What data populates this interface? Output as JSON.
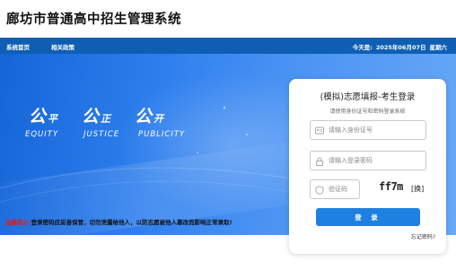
{
  "header": {
    "title": "廊坊市普通高中招生管理系统"
  },
  "nav": {
    "items": [
      {
        "label": "系统首页"
      },
      {
        "label": "相关政策"
      }
    ],
    "date_label": "今天是:",
    "date_value": "2025年06月07日",
    "weekday": "星期六"
  },
  "banner": {
    "slogan": [
      {
        "big": "公",
        "small": "平",
        "en": "EQUITY"
      },
      {
        "big": "公",
        "small": "正",
        "en": "JUSTICE"
      },
      {
        "big": "公",
        "small": "开",
        "en": "PUBLICITY"
      }
    ]
  },
  "notice": {
    "label": "温馨提示:",
    "text": "登录密码应妥善保管，切勿泄露给他人，以防志愿被他人篡改而影响正常录取!"
  },
  "login": {
    "title": "(模拟)志愿填报-考生登录",
    "subtitle": "请使用身份证号和密码登录系统",
    "id_placeholder": "请输入身份证号",
    "password_placeholder": "请输入登录密码",
    "code_placeholder": "验证码",
    "captcha_text": "ff7m",
    "refresh_label": "[换]",
    "button_label": "登 录",
    "forgot_label": "忘记密码?"
  },
  "colors": {
    "nav_bg": "#0e5fb4",
    "banner_start": "#1565d8",
    "banner_end": "#67a9f6",
    "button": "#1e80e0",
    "notice_label": "#d62020"
  },
  "icons": {
    "id_field": "id-card-icon",
    "password_field": "lock-icon",
    "code_field": "shield-icon"
  }
}
